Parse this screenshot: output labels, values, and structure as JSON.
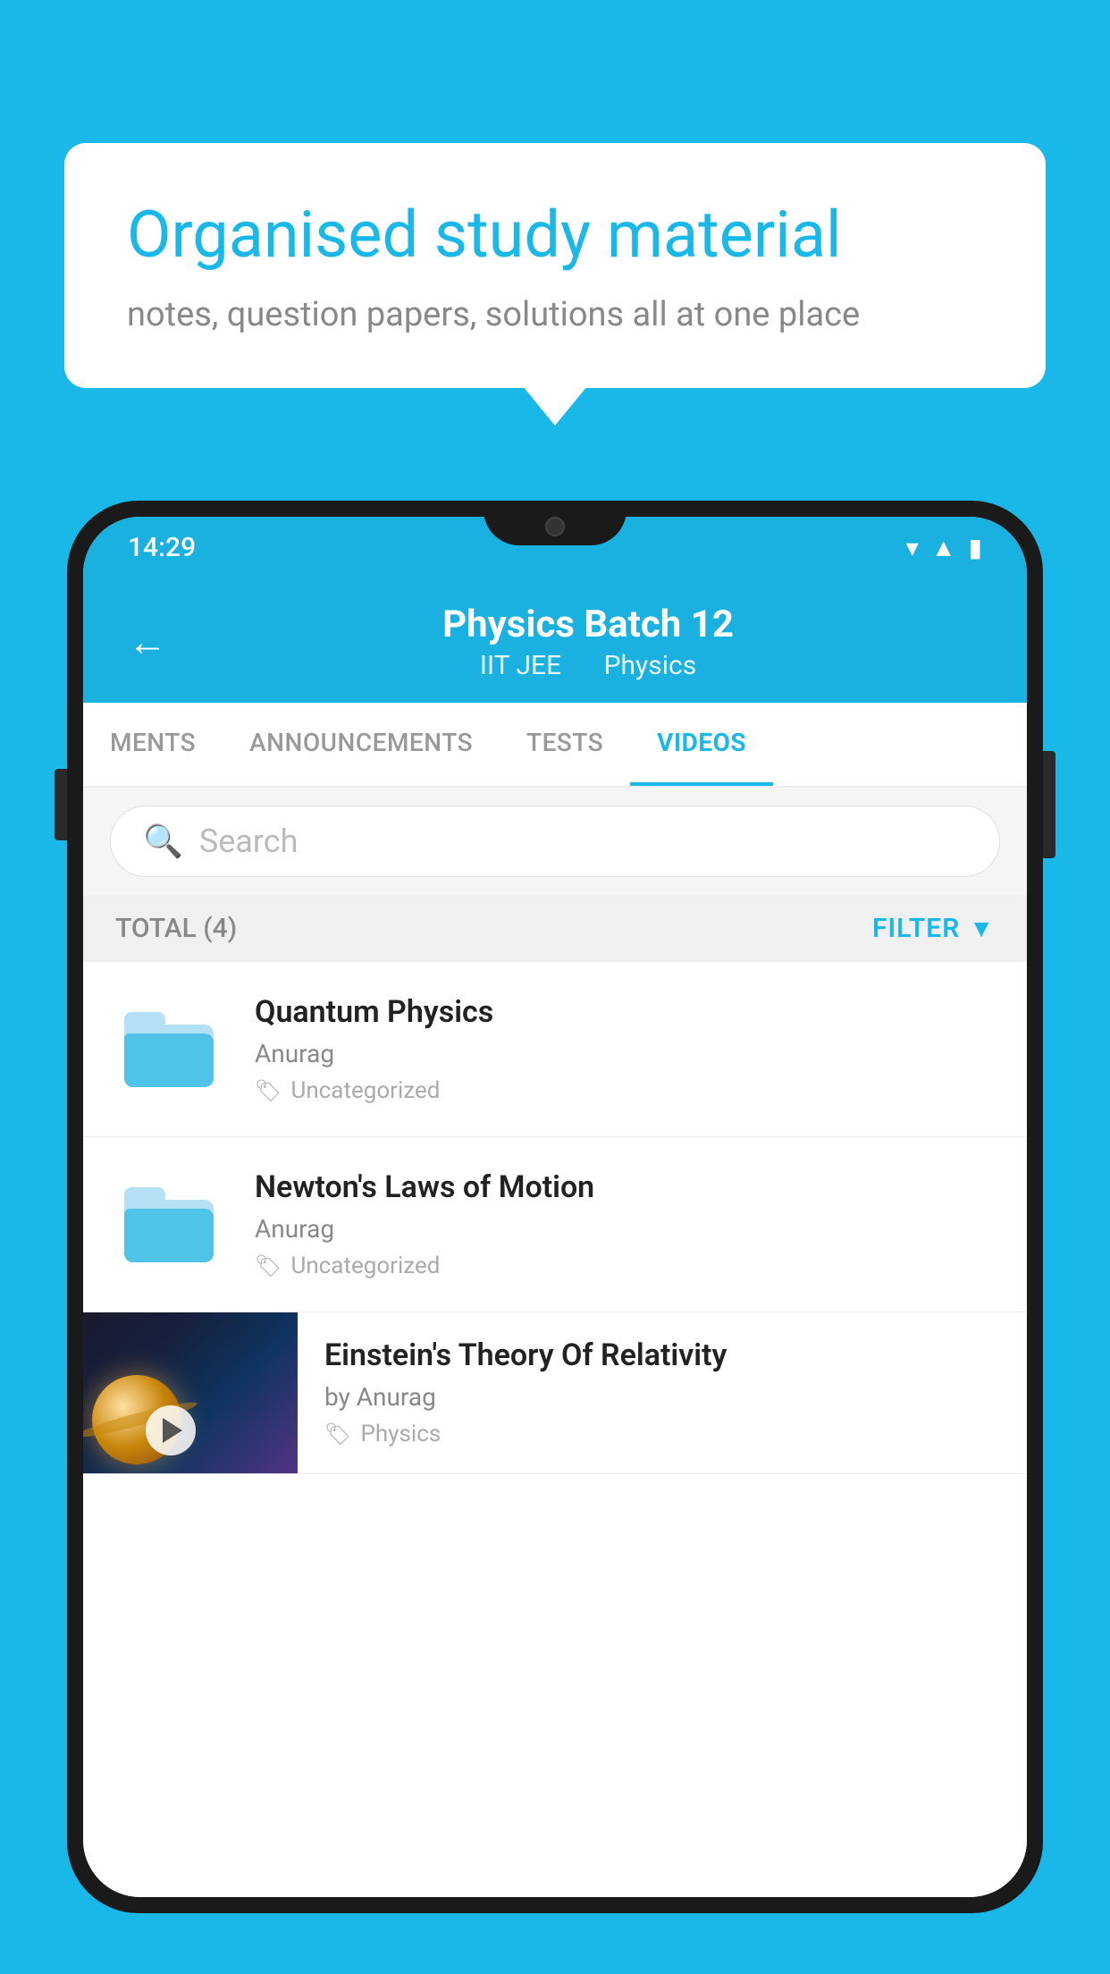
{
  "page": {
    "background_color": "#1ab8e8"
  },
  "speech_bubble": {
    "title": "Organised study material",
    "subtitle": "notes, question papers, solutions all at one place"
  },
  "phone": {
    "status_bar": {
      "time": "14:29"
    },
    "header": {
      "title": "Physics Batch 12",
      "subtitle_left": "IIT JEE",
      "subtitle_right": "Physics"
    },
    "tabs": [
      {
        "label": "MENTS",
        "active": false
      },
      {
        "label": "ANNOUNCEMENTS",
        "active": false
      },
      {
        "label": "TESTS",
        "active": false
      },
      {
        "label": "VIDEOS",
        "active": true
      }
    ],
    "search": {
      "placeholder": "Search"
    },
    "filter": {
      "total_label": "TOTAL (4)",
      "filter_label": "FILTER"
    },
    "videos": [
      {
        "title": "Quantum Physics",
        "author": "Anurag",
        "tag": "Uncategorized",
        "type": "folder"
      },
      {
        "title": "Newton's Laws of Motion",
        "author": "Anurag",
        "tag": "Uncategorized",
        "type": "folder"
      },
      {
        "title": "Einstein's Theory Of Relativity",
        "author": "by Anurag",
        "tag": "Physics",
        "type": "video"
      }
    ]
  }
}
